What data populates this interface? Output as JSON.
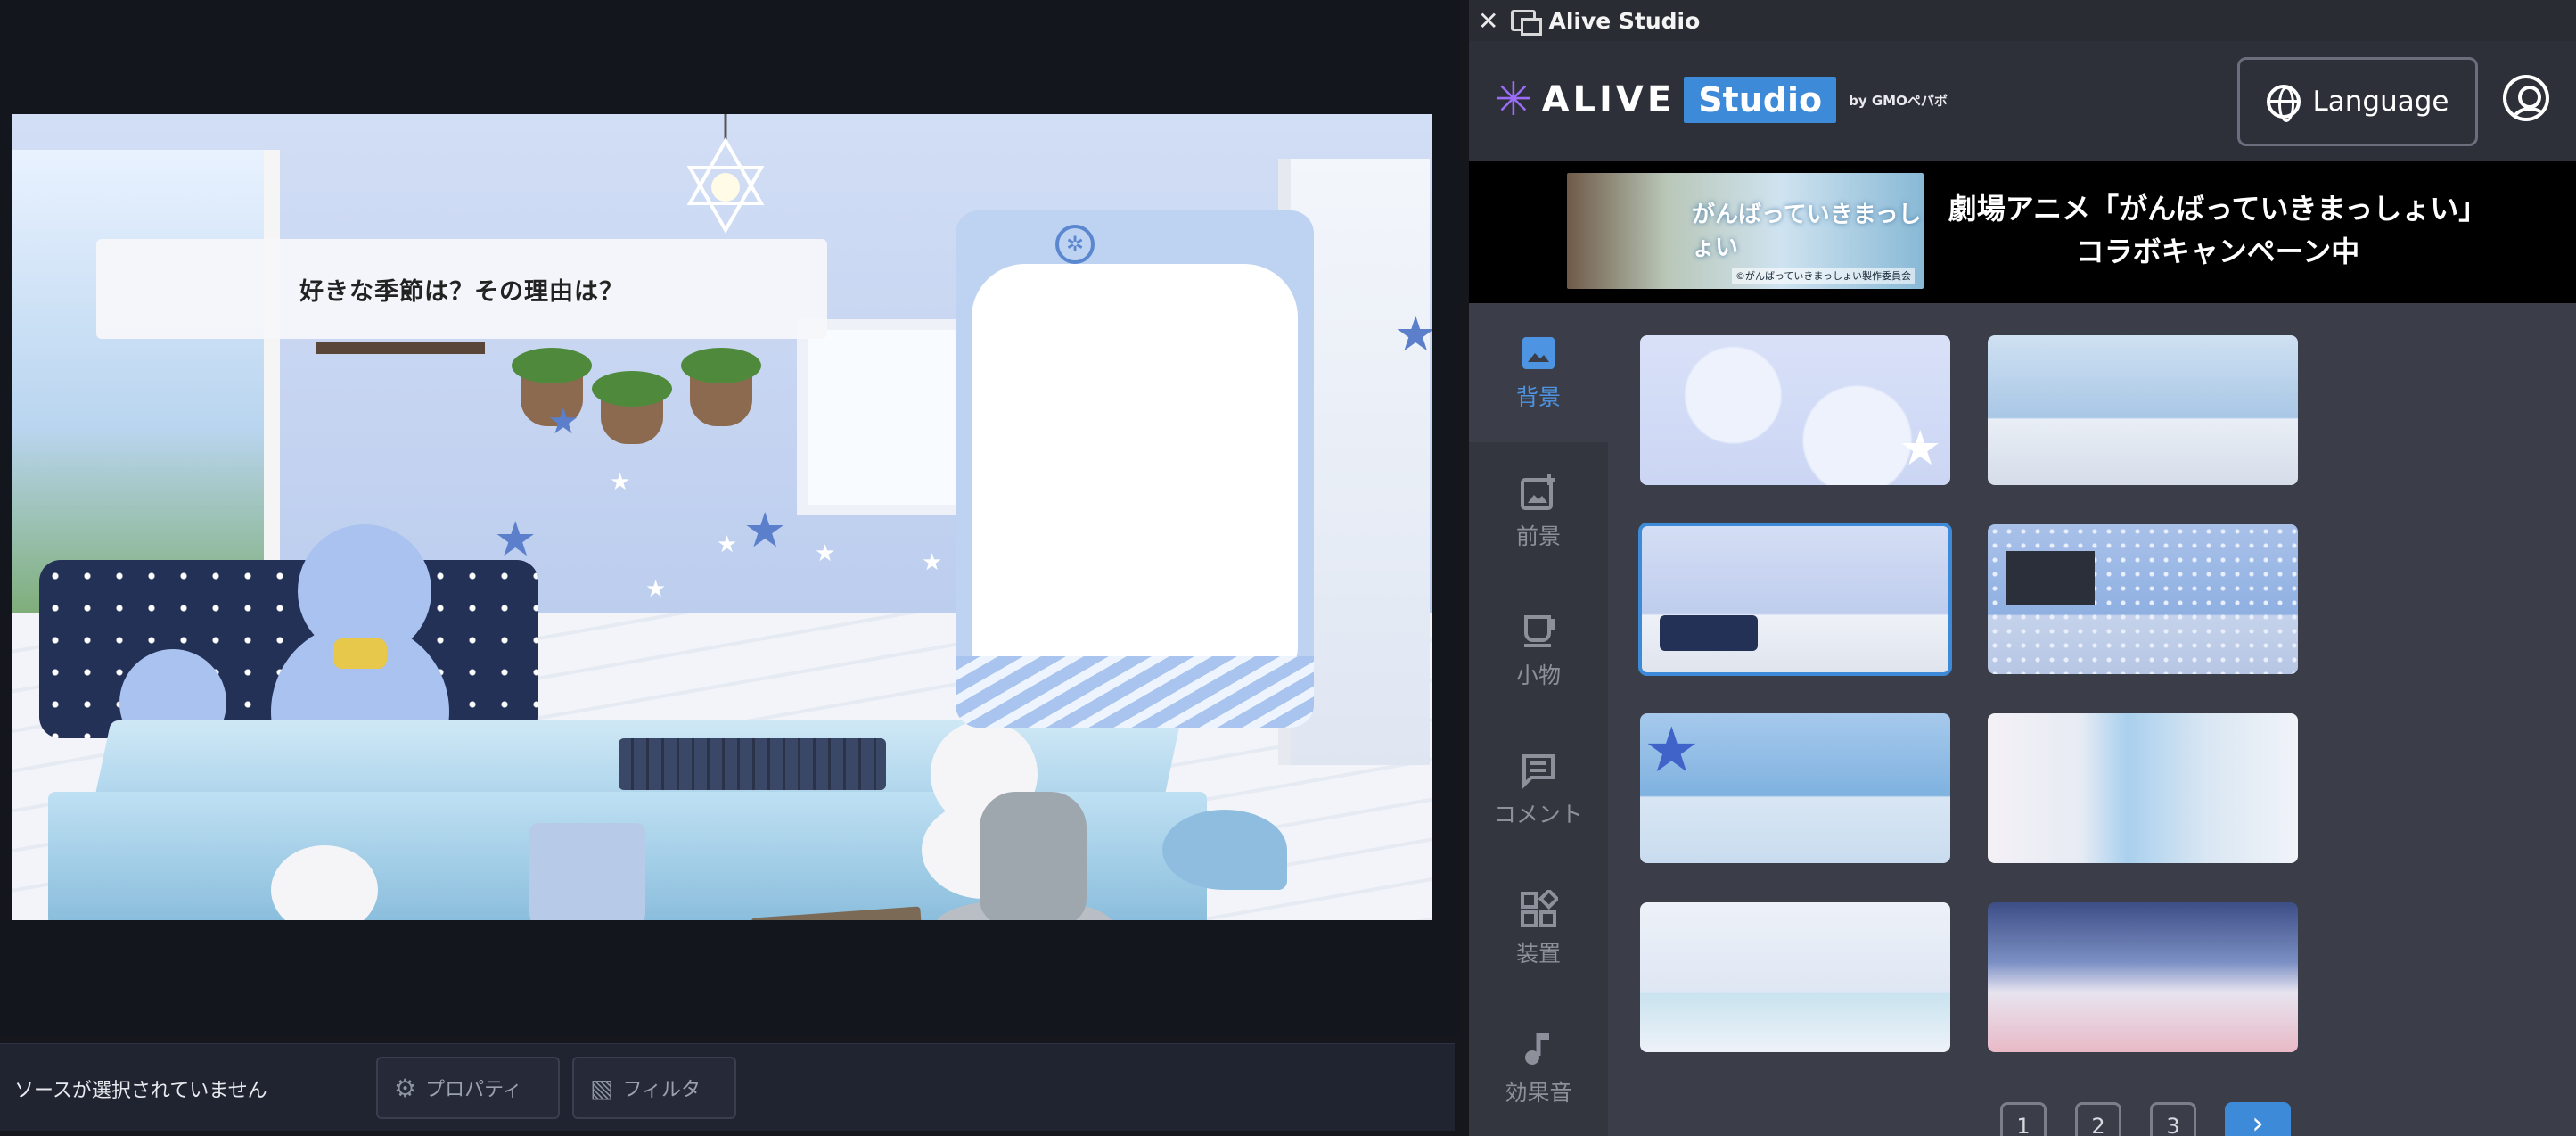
{
  "preview": {
    "question": "好きな季節は？その理由は？"
  },
  "status_bar": {
    "no_source": "ソースが選択されていません",
    "properties_label": "プロパティ",
    "filters_label": "フィルタ"
  },
  "dock": {
    "title": "Alive Studio",
    "close_glyph": "✕",
    "brand": {
      "alive": "ALIVE",
      "studio": "Studio",
      "by": "by GMOペパボ"
    },
    "language_label": "Language",
    "banner": {
      "art_title": "がんばっていきまっしょい",
      "art_credit": "©がんばっていきまっしょい製作委員会",
      "line1": "劇場アニメ「がんばっていきまっしょい」",
      "line2": "コラボキャンペーン中"
    },
    "nav": [
      {
        "label": "背景",
        "icon": "image-icon",
        "active": true
      },
      {
        "label": "前景",
        "icon": "image-plus-icon",
        "active": false
      },
      {
        "label": "小物",
        "icon": "cup-icon",
        "active": false
      },
      {
        "label": "コメント",
        "icon": "comment-icon",
        "active": false
      },
      {
        "label": "装置",
        "icon": "widgets-icon",
        "active": false
      },
      {
        "label": "効果音",
        "icon": "music-note-icon",
        "active": false
      }
    ],
    "pager": {
      "pages": [
        "1",
        "2",
        "3"
      ],
      "next_glyph": "›"
    }
  },
  "colors": {
    "accent": "#3d8bd8",
    "dock_bg": "#3b3e48",
    "nav_bg": "#34363f",
    "preview_bg": "#14161d"
  }
}
